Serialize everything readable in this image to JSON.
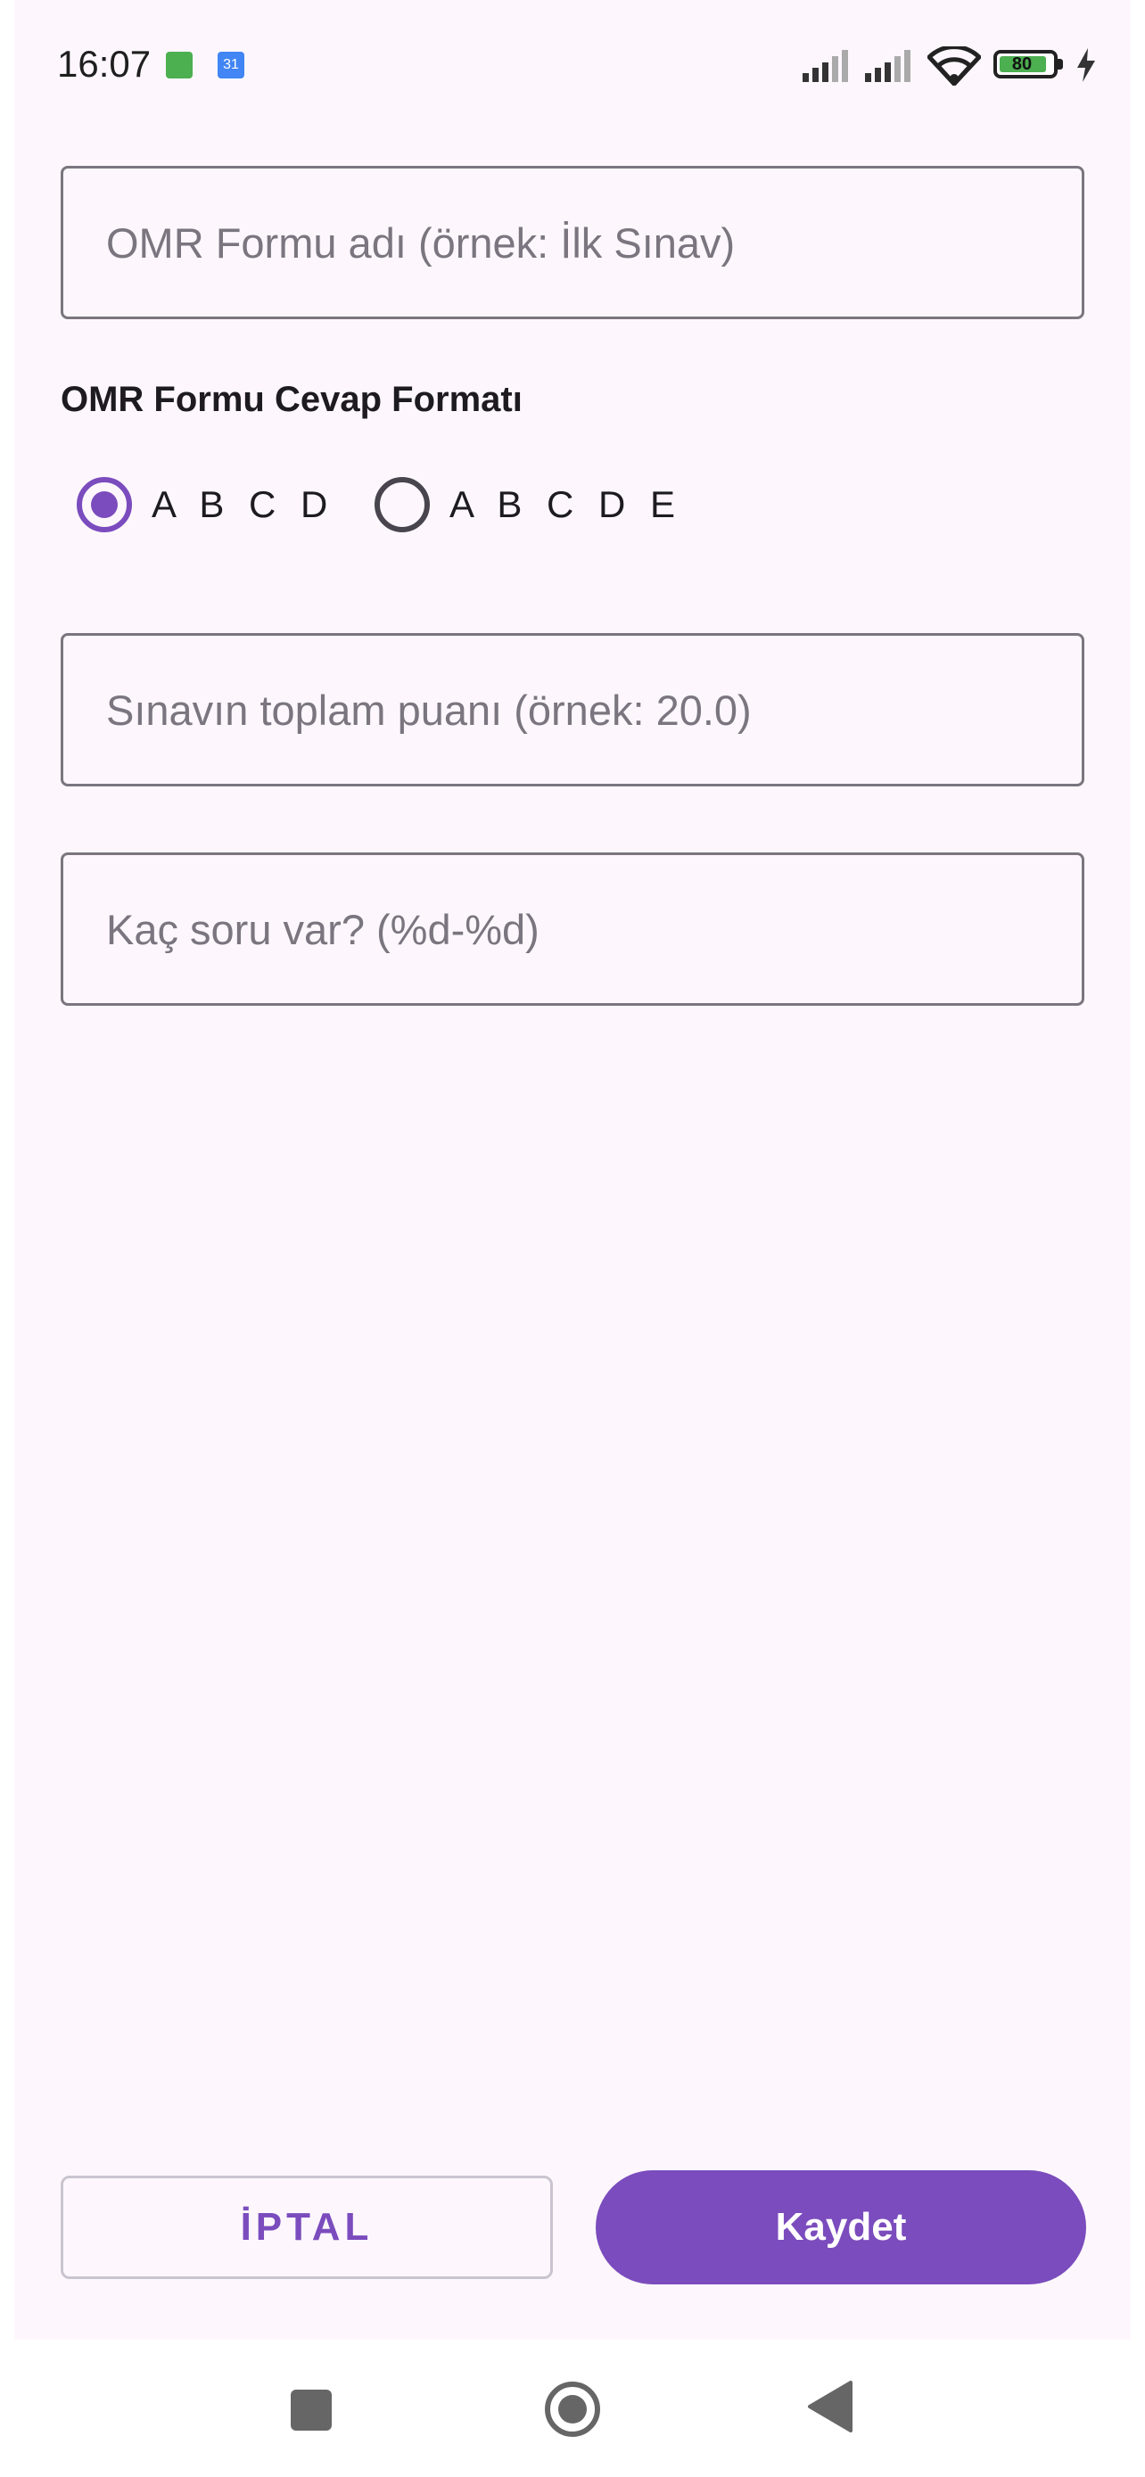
{
  "status_bar": {
    "time": "16:07",
    "calendar_day": "31",
    "battery_level": "80",
    "icons": [
      "android-notification-icon",
      "calendar-icon",
      "signal-icon",
      "signal-icon",
      "wifi-icon",
      "battery-icon",
      "charging-bolt-icon"
    ]
  },
  "form": {
    "name_placeholder": "OMR Formu adı (örnek: İlk Sınav)",
    "format_label": "OMR Formu Cevap Formatı",
    "options": [
      {
        "label": "A B C D",
        "selected": true
      },
      {
        "label": "A B C D E",
        "selected": false
      }
    ],
    "score_placeholder": "Sınavın toplam puanı (örnek: 20.0)",
    "count_placeholder": "Kaç soru var? (%d-%d)"
  },
  "actions": {
    "cancel_label": "İPTAL",
    "save_label": "Kaydet"
  },
  "colors": {
    "accent": "#7b4cbd",
    "background": "#fdf7fd",
    "outline": "#7a757f"
  },
  "nav": {
    "icons": [
      "recents-square-icon",
      "home-circle-icon",
      "back-triangle-icon"
    ]
  }
}
